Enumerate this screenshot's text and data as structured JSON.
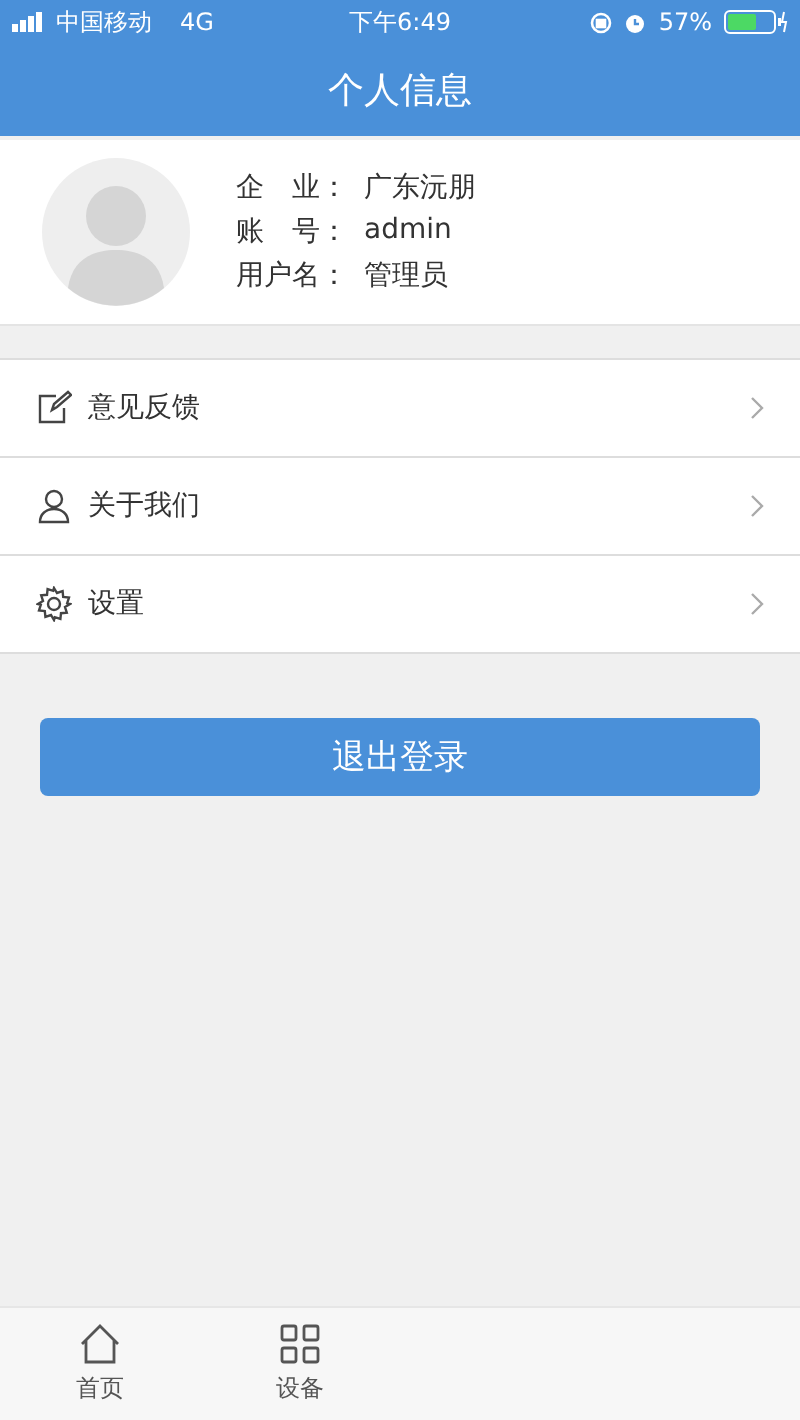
{
  "status_bar": {
    "carrier": "中国移动",
    "network": "4G",
    "time": "下午6:49",
    "battery": "57%"
  },
  "header": {
    "title": "个人信息"
  },
  "profile": {
    "fields": [
      {
        "label": "企　业：",
        "value": "广东沅朋"
      },
      {
        "label": "账　号：",
        "value": "admin"
      },
      {
        "label": "用户名：",
        "value": "管理员"
      }
    ]
  },
  "menu": [
    {
      "kind": "feedback",
      "label": "意见反馈"
    },
    {
      "kind": "about",
      "label": "关于我们"
    },
    {
      "kind": "settings",
      "label": "设置"
    }
  ],
  "logout_button": "退出登录",
  "tab_bar": [
    {
      "kind": "home",
      "label": "首页",
      "selected": false
    },
    {
      "kind": "devices",
      "label": "设备",
      "selected": false
    }
  ]
}
